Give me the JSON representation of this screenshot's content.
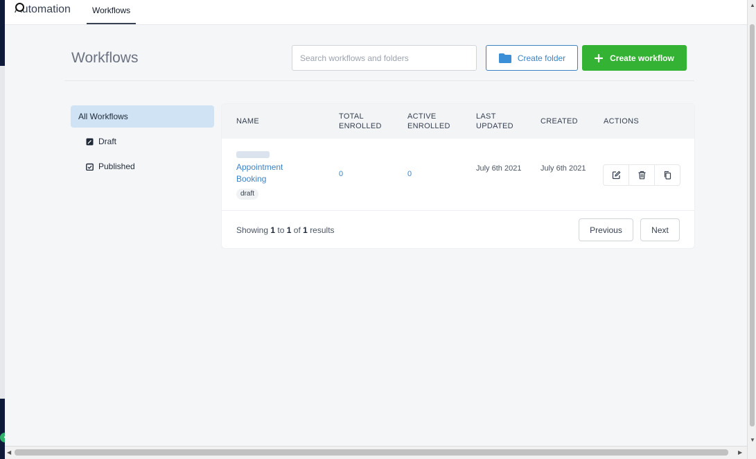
{
  "app": {
    "brand": "Automation",
    "top_tab": "Workflows"
  },
  "header": {
    "page_title": "Workflows",
    "search_placeholder": "Search workflows and folders",
    "create_folder_label": "Create folder",
    "create_workflow_label": "Create workflow"
  },
  "sidebar": {
    "items": [
      {
        "label": "All Workflows",
        "icon": "none",
        "selected": true
      },
      {
        "label": "Draft",
        "icon": "draft-icon"
      },
      {
        "label": "Published",
        "icon": "published-icon"
      }
    ]
  },
  "table": {
    "columns": [
      "NAME",
      "TOTAL\nENROLLED",
      "ACTIVE\nENROLLED",
      "LAST\nUPDATED",
      "CREATED",
      "ACTIONS"
    ],
    "rows": [
      {
        "name": "Appointment Booking",
        "status": "draft",
        "total_enrolled": "0",
        "active_enrolled": "0",
        "last_updated": "July 6th 2021",
        "created": "July 6th 2021",
        "actions": [
          "edit-icon",
          "trash-icon",
          "copy-icon"
        ]
      }
    ]
  },
  "pagination": {
    "showing_prefix": "Showing",
    "from": "1",
    "to_word": "to",
    "to": "1",
    "of_word": "of",
    "total": "1",
    "results_word": "results",
    "previous_label": "Previous",
    "next_label": "Next"
  },
  "colors": {
    "accent_blue": "#3b82c4",
    "create_green": "#34b233",
    "selected_bg": "#cfe3f5"
  }
}
